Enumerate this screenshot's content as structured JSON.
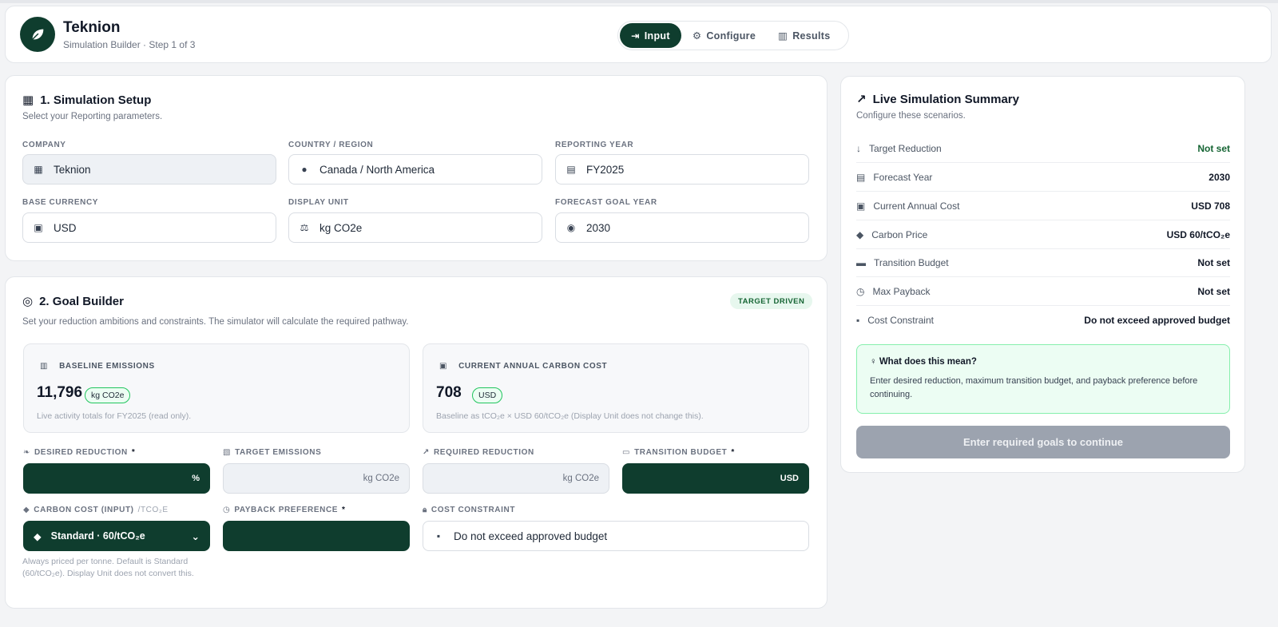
{
  "header": {
    "brand": "Teknion",
    "subtitle": "Simulation Builder · Step 1 of 3",
    "tabs": [
      {
        "label": "Input",
        "icon": "sign-in-icon",
        "active": true
      },
      {
        "label": "Configure",
        "icon": "gear-icon",
        "active": false
      },
      {
        "label": "Results",
        "icon": "bar-chart-icon",
        "active": false
      }
    ]
  },
  "setup": {
    "title": "1. Simulation Setup",
    "subtitle": "Select your Reporting parameters.",
    "fields": {
      "company": {
        "label": "COMPANY",
        "value": "Teknion"
      },
      "country": {
        "label": "COUNTRY / REGION",
        "value": "Canada / North America"
      },
      "reporting_year": {
        "label": "REPORTING YEAR",
        "value": "FY2025"
      },
      "base_currency": {
        "label": "BASE CURRENCY",
        "value": "USD"
      },
      "display_unit": {
        "label": "DISPLAY UNIT",
        "value": "kg CO2e"
      },
      "goal_year": {
        "label": "FORECAST GOAL YEAR",
        "value": "2030"
      }
    }
  },
  "goal": {
    "title": "2. Goal Builder",
    "badge": "TARGET DRIVEN",
    "subtitle": "Set your reduction ambitions and constraints. The simulator will calculate the required pathway.",
    "baseline": {
      "label": "BASELINE EMISSIONS",
      "value": "11,796",
      "unit": "kg CO2e",
      "note": "Live activity totals for FY2025 (read only)."
    },
    "carbon_cost": {
      "label": "CURRENT ANNUAL CARBON COST",
      "value": "708",
      "unit": "USD",
      "note": "Baseline as tCO₂e × USD 60/tCO₂e (Display Unit does not change this)."
    },
    "desired_reduction": {
      "label": "DESIRED REDUCTION",
      "required": "*",
      "suffix": "%"
    },
    "target_emissions": {
      "label": "TARGET EMISSIONS",
      "suffix": "kg CO2e"
    },
    "required_reduction": {
      "label": "REQUIRED REDUCTION",
      "suffix": "kg CO2e"
    },
    "transition_budget": {
      "label": "TRANSITION BUDGET",
      "required": "*",
      "suffix": "USD"
    },
    "carbon_cost_input": {
      "label": "CARBON COST (INPUT)",
      "label_suffix": "/tCO₂e",
      "value": "Standard · 60/tCO₂e"
    },
    "payback": {
      "label": "PAYBACK PREFERENCE",
      "required": "*"
    },
    "cost_constraint": {
      "label": "COST CONSTRAINT",
      "value": "Do not exceed approved budget"
    },
    "hint": "Always priced per tonne. Default is Standard (60/tCO₂e). Display Unit does not convert this."
  },
  "summary": {
    "title": "Live Simulation Summary",
    "subtitle": "Configure these scenarios.",
    "rows": [
      {
        "key": "Target Reduction",
        "value": "Not set"
      },
      {
        "key": "Forecast Year",
        "value": "2030"
      },
      {
        "key": "Current Annual Cost",
        "value": "USD 708"
      },
      {
        "key": "Carbon Price",
        "value": "USD 60/tCO₂e"
      },
      {
        "key": "Transition Budget",
        "value": "Not set"
      },
      {
        "key": "Max Payback",
        "value": "Not set"
      },
      {
        "key": "Cost Constraint",
        "value": "Do not exceed approved budget"
      }
    ],
    "info_title": "What does this mean?",
    "info_text": "Enter desired reduction, maximum transition budget, and payback preference before continuing.",
    "cta": "Enter required goals to continue"
  },
  "colors": {
    "brand": "#0f3d2e",
    "accent_green": "#166534",
    "disabled": "#9ca3af"
  }
}
